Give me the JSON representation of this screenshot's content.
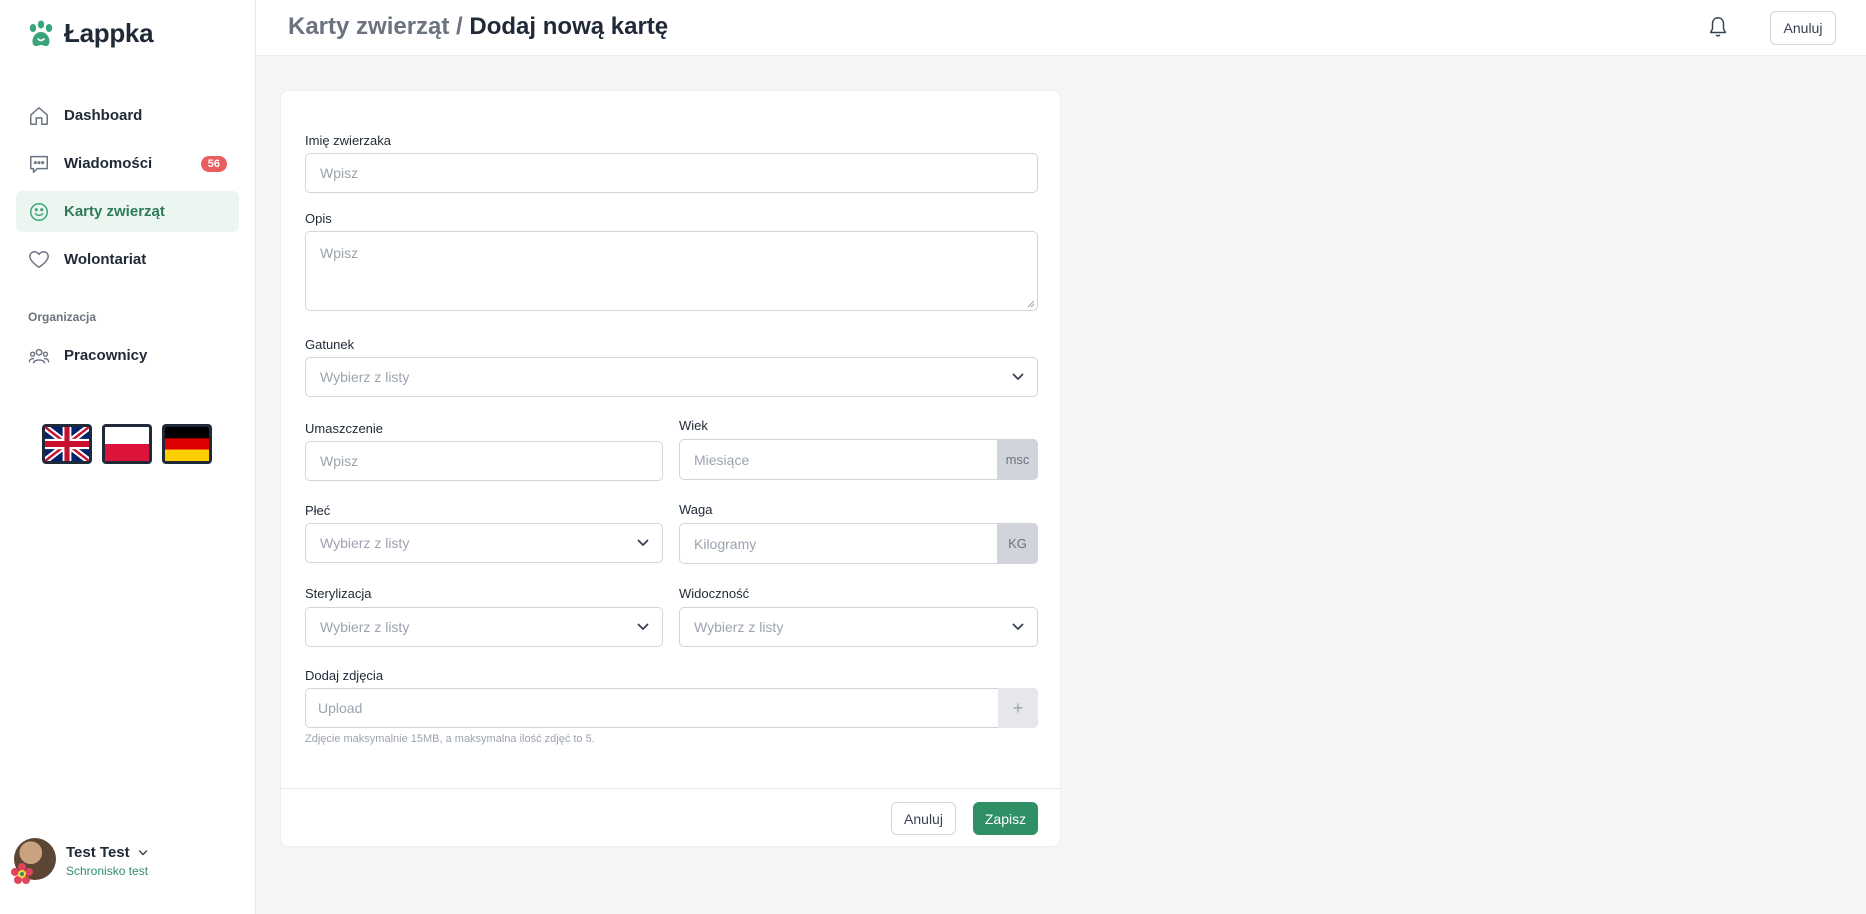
{
  "app": {
    "name": "Łappka"
  },
  "sidebar": {
    "items": [
      {
        "label": "Dashboard",
        "icon": "home-icon"
      },
      {
        "label": "Wiadomości",
        "icon": "chat-icon",
        "badge": "56"
      },
      {
        "label": "Karty zwierząt",
        "icon": "smile-icon",
        "active": true
      },
      {
        "label": "Wolontariat",
        "icon": "heart-icon"
      }
    ],
    "section_label": "Organizacja",
    "org_items": [
      {
        "label": "Pracownicy",
        "icon": "users-icon"
      }
    ],
    "languages": [
      "flag-uk-icon",
      "flag-pl-icon",
      "flag-de-icon"
    ]
  },
  "user": {
    "name": "Test Test",
    "org": "Schronisko test"
  },
  "header": {
    "breadcrumb_parent": "Karty zwierząt /",
    "breadcrumb_current": "Dodaj nową kartę",
    "cancel_label": "Anuluj"
  },
  "form": {
    "name": {
      "label": "Imię zwierzaka",
      "placeholder": "Wpisz"
    },
    "description": {
      "label": "Opis",
      "placeholder": "Wpisz"
    },
    "species": {
      "label": "Gatunek",
      "placeholder": "Wybierz z listy"
    },
    "color": {
      "label": "Umaszczenie",
      "placeholder": "Wpisz"
    },
    "age": {
      "label": "Wiek",
      "placeholder": "Miesiące",
      "unit": "msc"
    },
    "sex": {
      "label": "Płeć",
      "placeholder": "Wybierz z listy"
    },
    "weight": {
      "label": "Waga",
      "placeholder": "Kilogramy",
      "unit": "KG"
    },
    "sterilization": {
      "label": "Sterylizacja",
      "placeholder": "Wybierz z listy"
    },
    "visibility": {
      "label": "Widoczność",
      "placeholder": "Wybierz z listy"
    },
    "photos": {
      "label": "Dodaj zdjęcia",
      "placeholder": "Upload",
      "add": "+",
      "help": "Zdjęcie maksymalnie 15MB, a maksymalna ilość zdjęć to 5."
    },
    "cancel_label": "Anuluj",
    "save_label": "Zapisz"
  },
  "colors": {
    "accent": "#2f8f65",
    "badge": "#e85d5d",
    "active_bg": "#ebf6f1"
  }
}
